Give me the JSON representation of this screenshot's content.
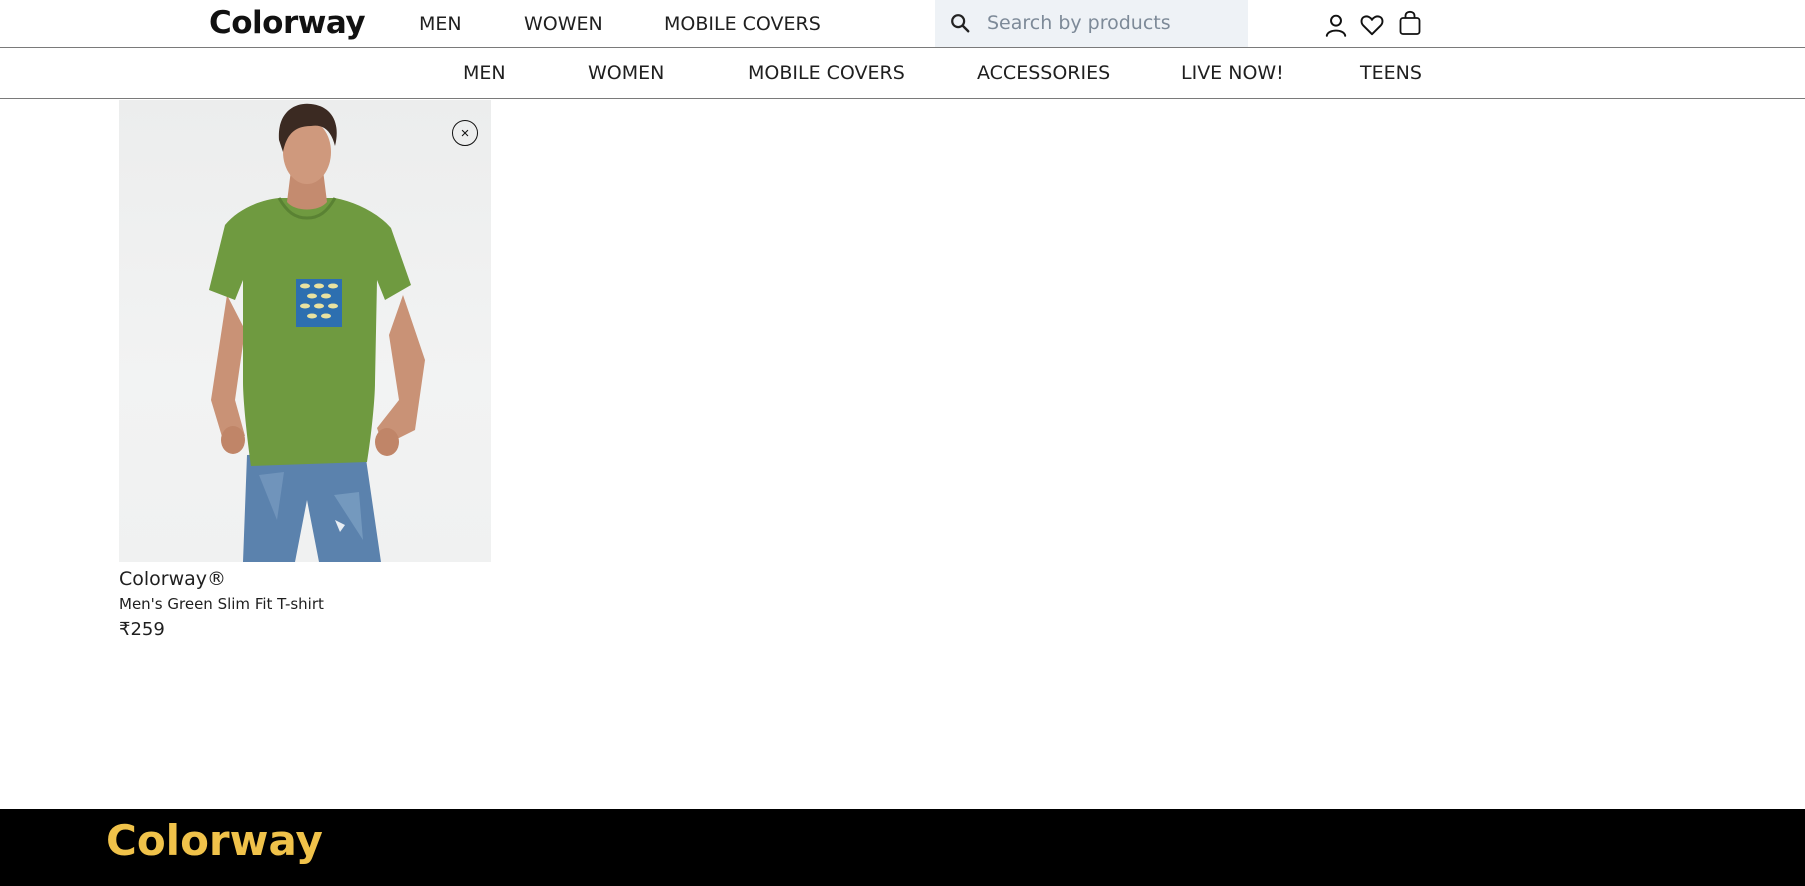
{
  "header": {
    "logo": "Colorway",
    "nav": [
      "MEN",
      "WOWEN",
      "MOBILE COVERS"
    ],
    "search": {
      "placeholder": "Search by products",
      "value": ""
    },
    "icons": [
      "user-icon",
      "heart-icon",
      "bag-icon"
    ]
  },
  "sub_nav": [
    "MEN",
    "WOMEN",
    "MOBILE COVERS",
    "ACCESSORIES",
    "LIVE NOW!",
    "TEENS"
  ],
  "wishlist": {
    "items": [
      {
        "brand": "Colorway®",
        "name": "Men's Green Slim Fit T-shirt",
        "price": "₹259",
        "remove_icon": "close-icon",
        "remove_label": "×",
        "image": "man-in-green-tshirt-photo"
      }
    ]
  },
  "footer": {
    "logo": "Colorway"
  },
  "colors": {
    "search_bg": "#eef2f6",
    "footer_bg": "#000000",
    "footer_logo": "#f0c24a",
    "tshirt_green": "#6f9a40"
  }
}
